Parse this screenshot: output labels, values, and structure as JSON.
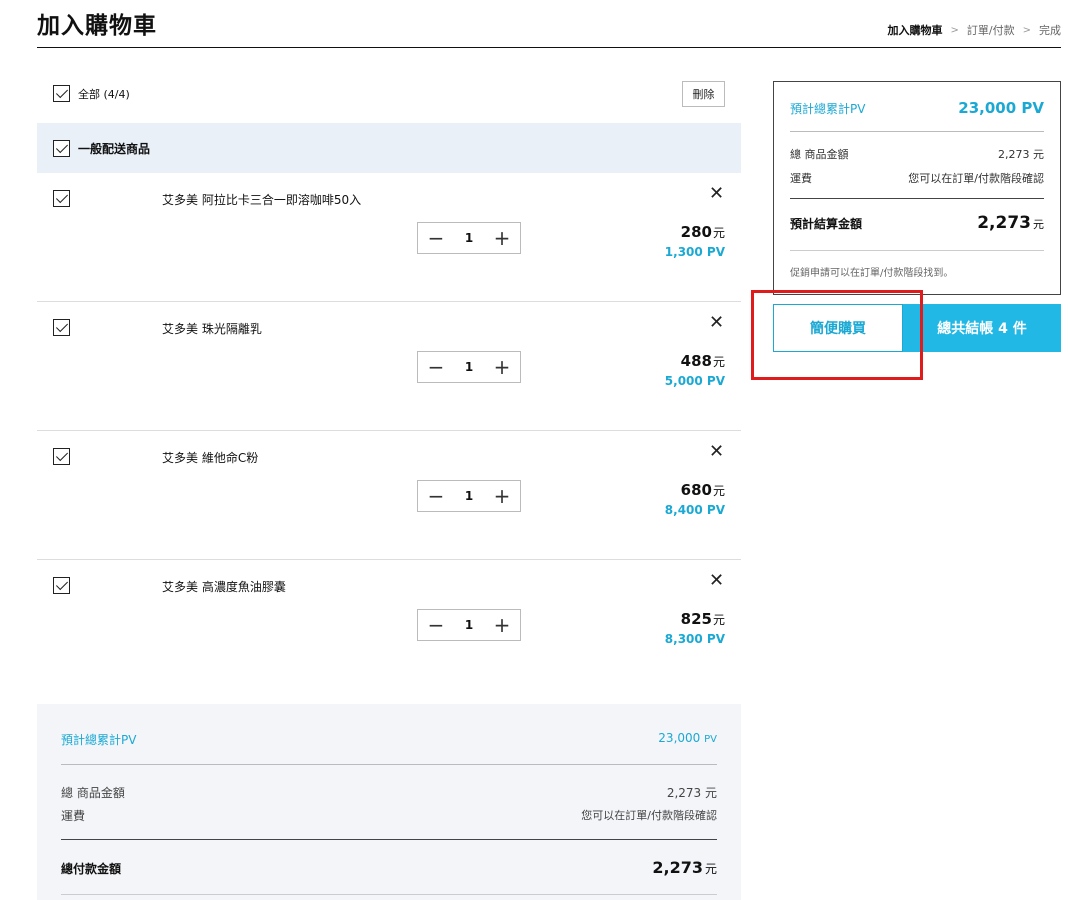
{
  "header": {
    "title": "加入購物車",
    "steps": [
      "加入購物車",
      "訂單/付款",
      "完成"
    ],
    "step_separator": ">"
  },
  "toolbar": {
    "select_all_label": "全部 (4/4)",
    "delete_label": "刪除"
  },
  "group": {
    "label": "一般配送商品"
  },
  "currency": "元",
  "pv_unit": "PV",
  "items": [
    {
      "name": "艾多美 阿拉比卡三合一即溶咖啡50入",
      "qty": "1",
      "price": "280",
      "pv": "1,300 PV"
    },
    {
      "name": "艾多美 珠光隔離乳",
      "qty": "1",
      "price": "488",
      "pv": "5,000 PV"
    },
    {
      "name": "艾多美 維他命C粉",
      "qty": "1",
      "price": "680",
      "pv": "8,400 PV"
    },
    {
      "name": "艾多美 高濃度魚油膠囊",
      "qty": "1",
      "price": "825",
      "pv": "8,300 PV"
    }
  ],
  "stepper": {
    "minus": "−",
    "plus": "+"
  },
  "remove_glyph": "✕",
  "summary_card": {
    "pv_label": "預計總累計PV",
    "pv_value": "23,000 PV",
    "subtotal_label": "總 商品金額",
    "subtotal_value": "2,273 元",
    "shipping_label": "運費",
    "shipping_value": "您可以在訂單/付款階段確認",
    "total_label": "預計結算金額",
    "total_value": "2,273",
    "note": "促銷申請可以在訂單/付款階段找到。"
  },
  "buttons": {
    "quick_buy": "簡便購買",
    "checkout": "總共結帳 4 件"
  },
  "bottom_summary": {
    "pv_label": "預計總累計PV",
    "pv_value": "23,000",
    "pv_unit": "PV",
    "subtotal_label": "總 商品金額",
    "subtotal_value": "2,273 元",
    "shipping_label": "運費",
    "shipping_value": "您可以在訂單/付款階段確認",
    "total_label": "總付款金額",
    "total_value": "2,273"
  },
  "colors": {
    "accent": "#22b8e6",
    "pv_text": "#1ba9d4",
    "highlight": "#e01b1b",
    "group_bg": "#e9f0f8"
  }
}
